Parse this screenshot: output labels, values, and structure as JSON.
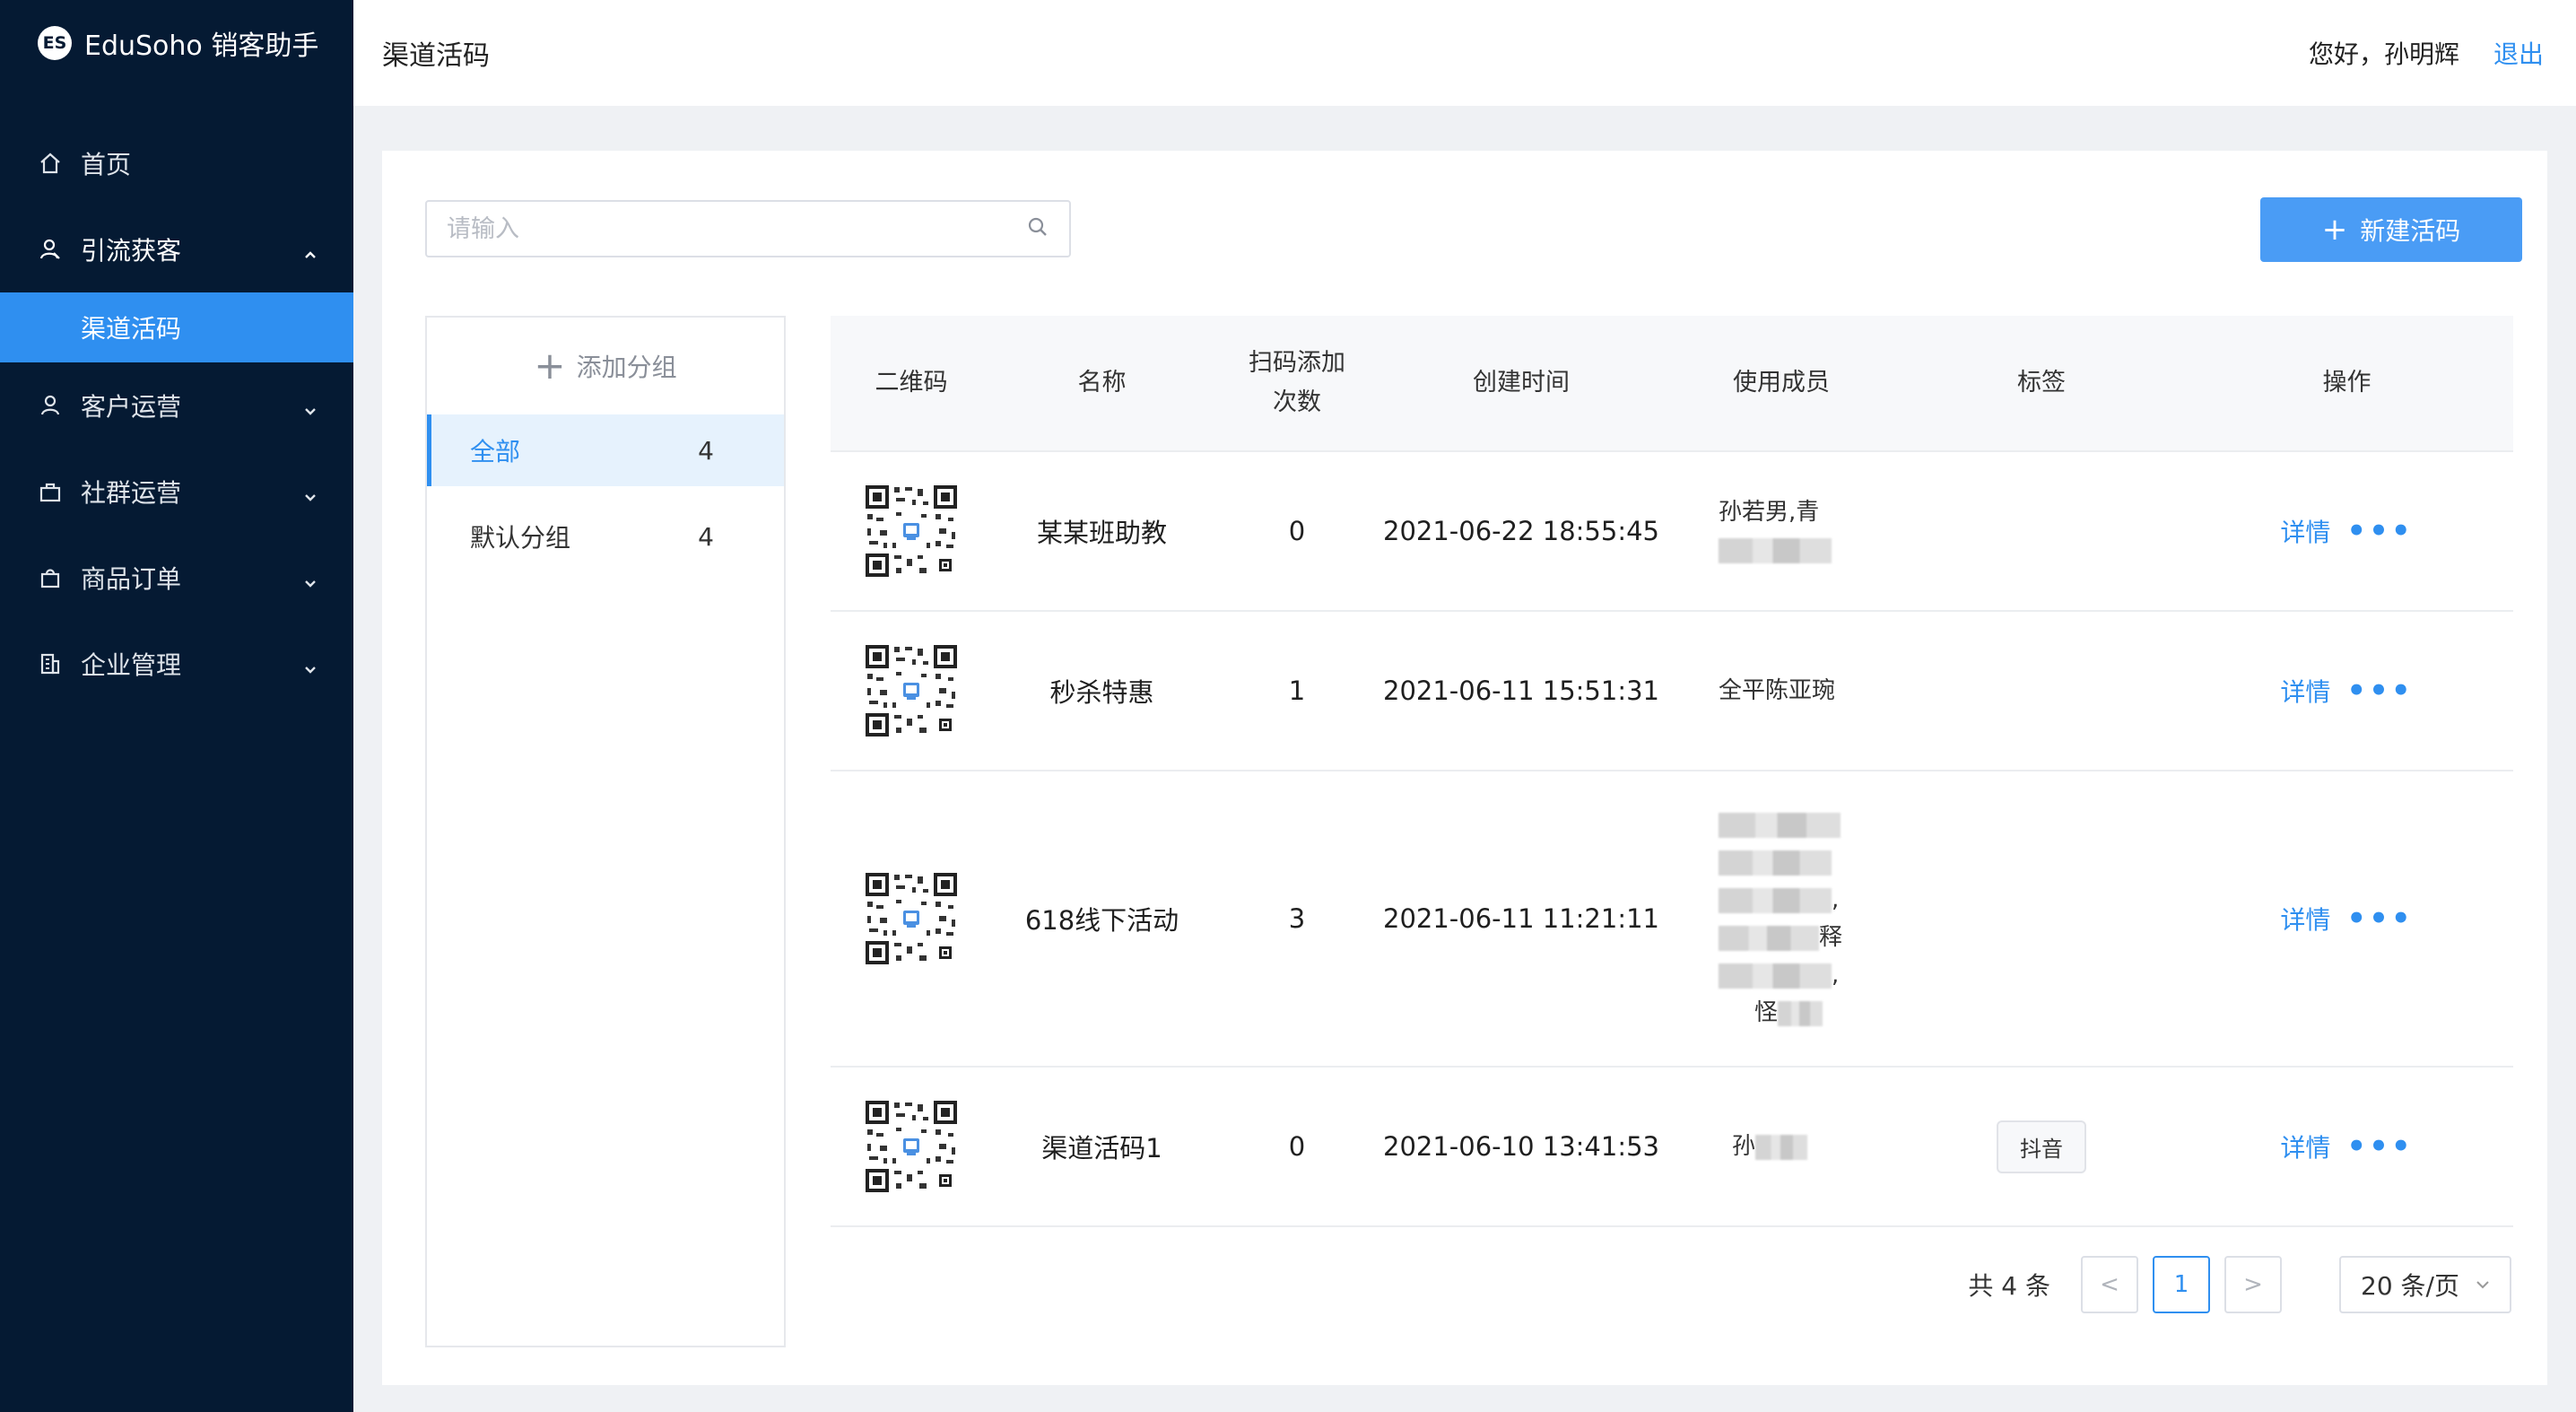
{
  "app": {
    "logo_text": "ES",
    "name": "EduSoho 销客助手"
  },
  "header": {
    "title": "渠道活码",
    "greeting": "您好，孙明辉",
    "logout": "退出"
  },
  "sidebar": {
    "items": [
      {
        "label": "首页",
        "icon": "home-icon"
      },
      {
        "label": "引流获客",
        "icon": "user-acquire-icon",
        "expanded": true,
        "children": [
          {
            "label": "渠道活码",
            "active": true
          }
        ]
      },
      {
        "label": "客户运营",
        "icon": "user-icon"
      },
      {
        "label": "社群运营",
        "icon": "briefcase-icon"
      },
      {
        "label": "商品订单",
        "icon": "bag-icon"
      },
      {
        "label": "企业管理",
        "icon": "building-icon"
      }
    ]
  },
  "toolbar": {
    "search_placeholder": "请输入",
    "new_button": "新建活码"
  },
  "groups": {
    "add_label": "添加分组",
    "items": [
      {
        "label": "全部",
        "count": "4"
      },
      {
        "label": "默认分组",
        "count": "4"
      }
    ]
  },
  "table": {
    "headers": {
      "qr": "二维码",
      "name": "名称",
      "scans_line1": "扫码添加",
      "scans_line2": "次数",
      "created": "创建时间",
      "members": "使用成员",
      "tags": "标签",
      "actions": "操作"
    },
    "rows": [
      {
        "name": "某某班助教",
        "scans": "0",
        "created": "2021-06-22 18:55:45",
        "members": [
          "孙若男,青"
        ],
        "tag": ""
      },
      {
        "name": "秒杀特惠",
        "scans": "1",
        "created": "2021-06-11 15:51:31",
        "members": [
          "全平陈亚琬"
        ],
        "tag": ""
      },
      {
        "name": "618线下活动",
        "scans": "3",
        "created": "2021-06-11 11:21:11",
        "members": [
          "",
          "",
          ",",
          "释",
          ",",
          "怪"
        ],
        "tag": ""
      },
      {
        "name": "渠道活码1",
        "scans": "0",
        "created": "2021-06-10 13:41:53",
        "members": [
          "孙"
        ],
        "tag": "抖音"
      }
    ],
    "detail_label": "详情",
    "more_label": "•••"
  },
  "pagination": {
    "total": "共 4 条",
    "current_page": "1",
    "page_size": "20 条/页",
    "prev": "<",
    "next": ">"
  },
  "colors": {
    "sidebar_bg": "#051a33",
    "accent": "#2f8ff0",
    "button": "#4a9cf5"
  }
}
